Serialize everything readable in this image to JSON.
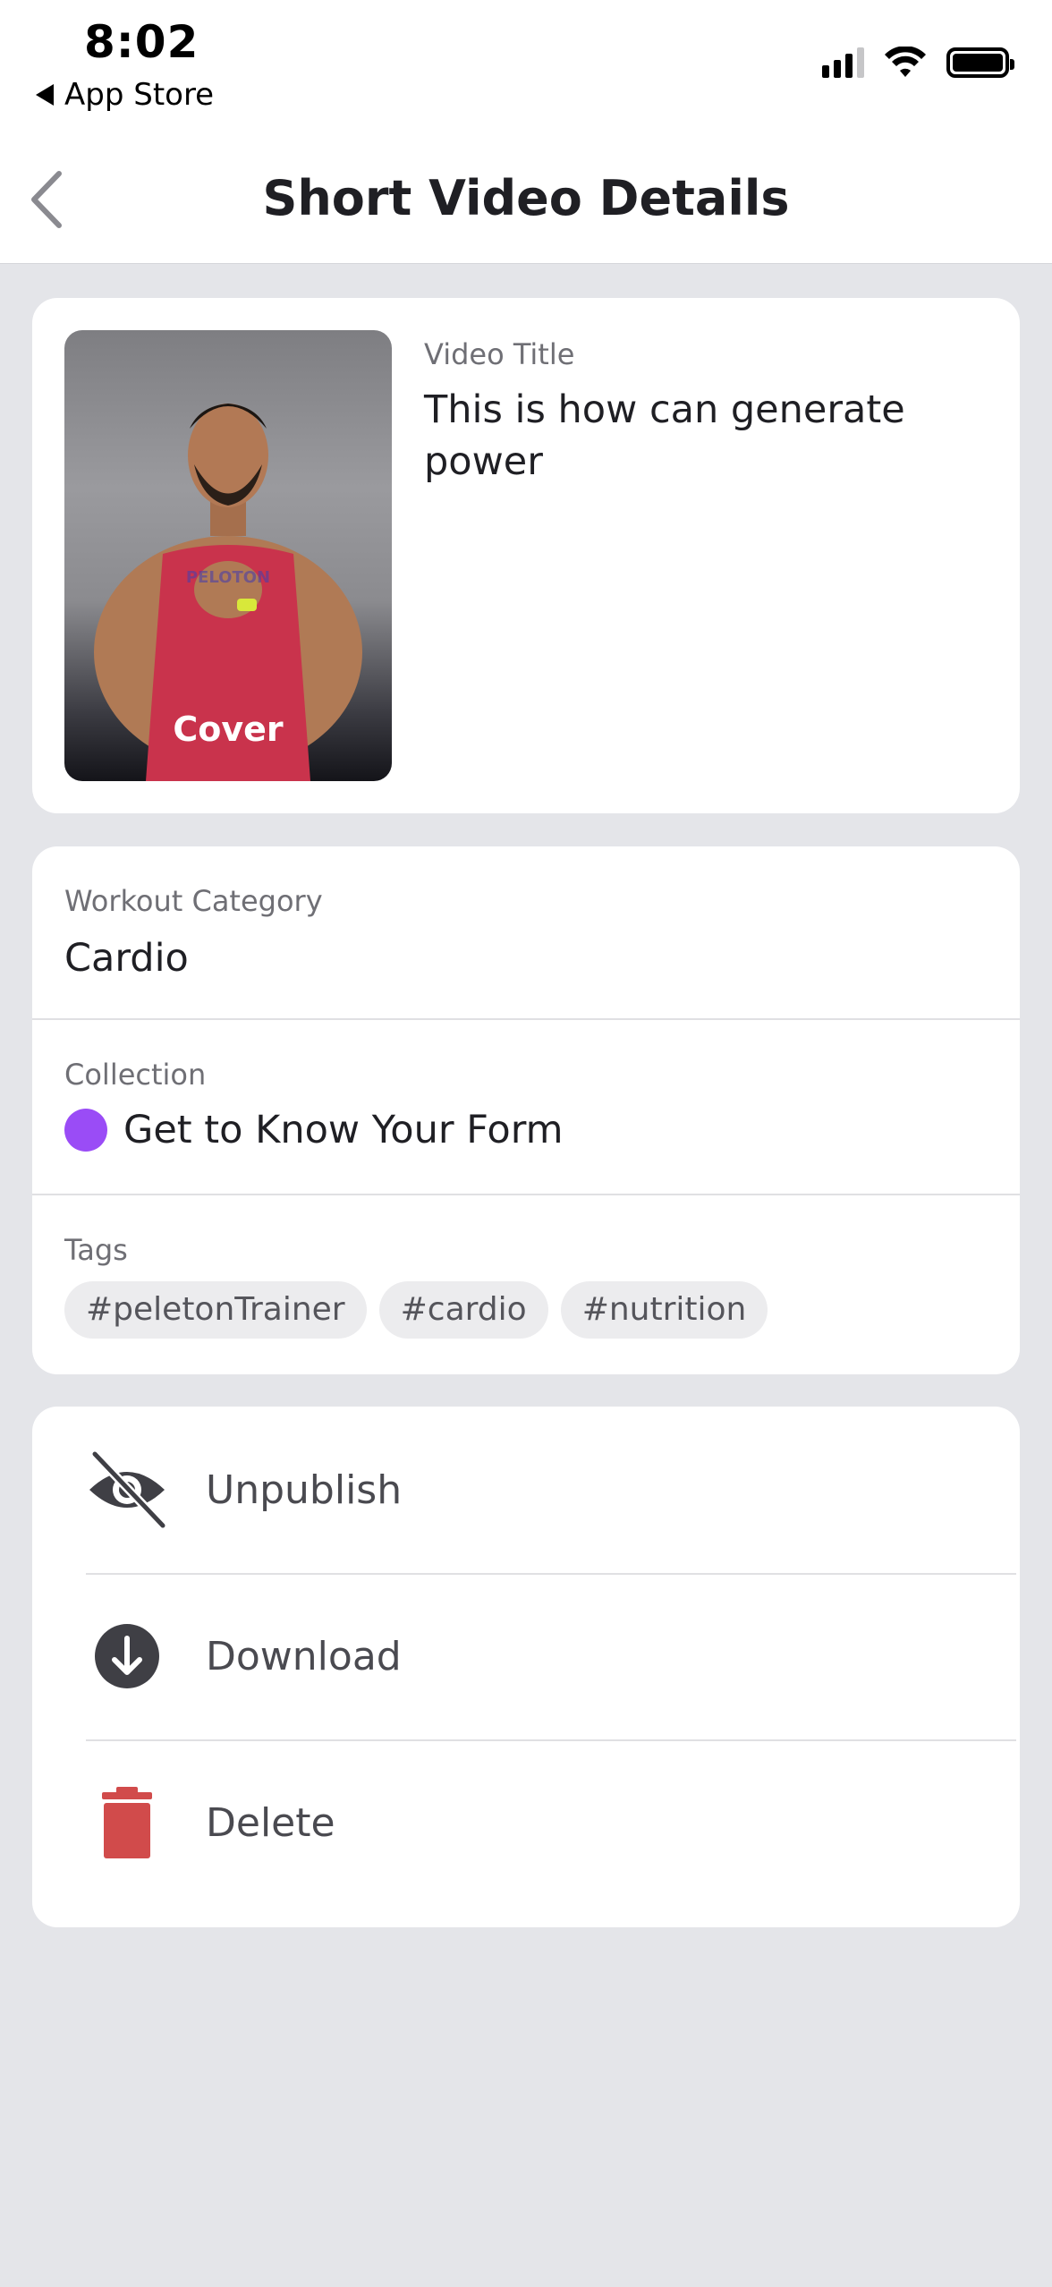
{
  "status_bar": {
    "time": "8:02",
    "back_app": "App Store"
  },
  "nav": {
    "title": "Short Video Details"
  },
  "video": {
    "cover_label": "Cover",
    "title_label": "Video Title",
    "title": "This is how can generate power"
  },
  "details": {
    "category_label": "Workout Category",
    "category": "Cardio",
    "collection_label": "Collection",
    "collection": "Get to Know Your Form",
    "collection_color": "#9a4cf6",
    "tags_label": "Tags",
    "tags": [
      "#peletonTrainer",
      "#cardio",
      "#nutrition"
    ]
  },
  "actions": {
    "unpublish": "Unpublish",
    "download": "Download",
    "delete": "Delete",
    "delete_color": "#d14b4b"
  },
  "icons": {
    "back": "chevron-left-icon",
    "unpublish": "eye-slash-icon",
    "download": "download-circle-icon",
    "delete": "trash-icon"
  }
}
